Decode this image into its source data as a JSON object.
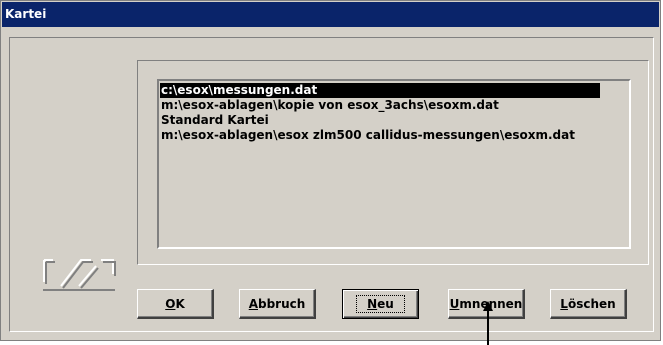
{
  "window": {
    "title": "Kartei"
  },
  "list": {
    "items": [
      {
        "label": "c:\\esox\\messungen.dat",
        "selected": true
      },
      {
        "label": "m:\\esox-ablagen\\kopie von esox_3achs\\esoxm.dat",
        "selected": false
      },
      {
        "label": "Standard Kartei",
        "selected": false
      },
      {
        "label": "m:\\esox-ablagen\\esox zlm500 callidus-messungen\\esoxm.dat",
        "selected": false
      }
    ]
  },
  "buttons": {
    "ok": {
      "accel": "O",
      "rest": "K"
    },
    "abbruch": {
      "accel": "A",
      "rest": "bbruch"
    },
    "neu": {
      "accel": "N",
      "rest": "eu"
    },
    "umbenennen": {
      "accel": "U",
      "rest": "mnennen"
    },
    "loeschen": {
      "accel": "L",
      "rest": "öschen"
    }
  },
  "logo": {
    "icon": "karteikarten-logo-icon"
  },
  "pointer": {
    "icon": "arrow-up-icon"
  }
}
